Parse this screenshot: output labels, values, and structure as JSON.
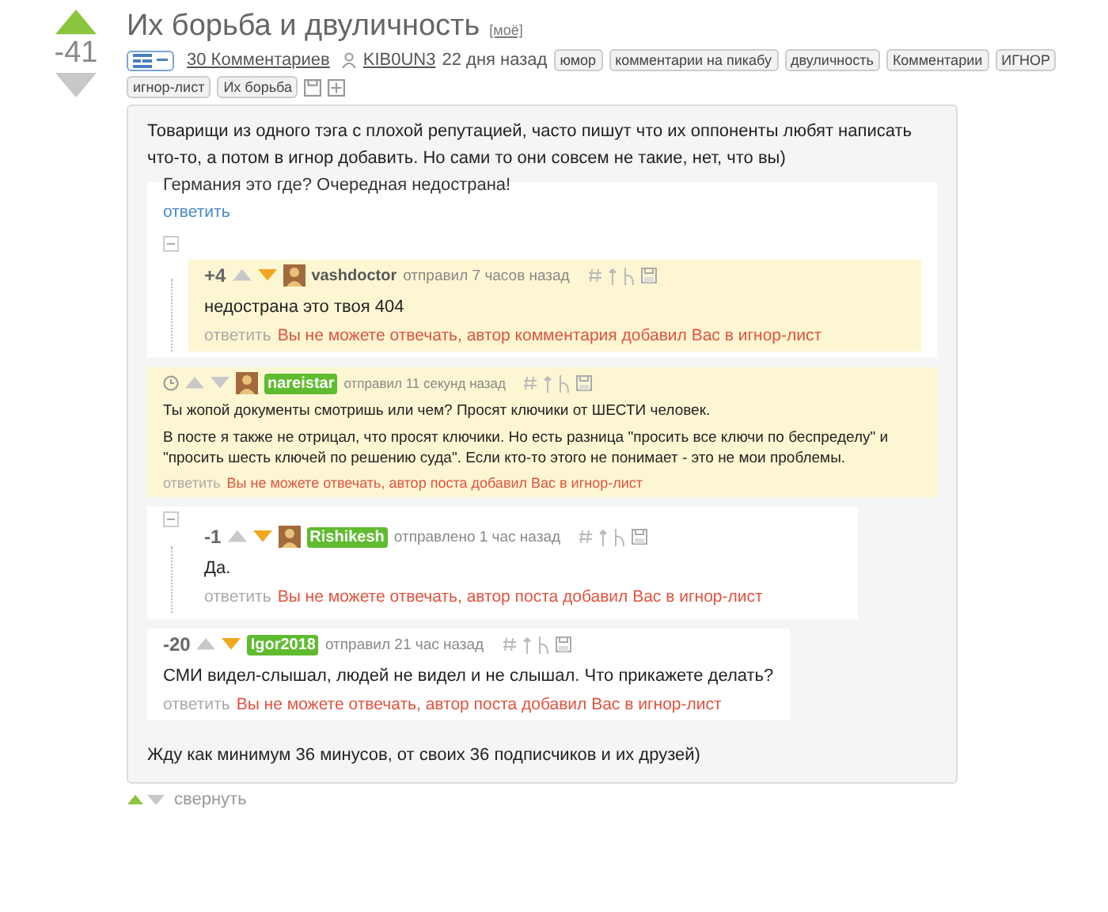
{
  "post": {
    "rating": "-41",
    "voted_up": true,
    "voted_down": false,
    "title": "Их борьба и двуличность",
    "mine_label": "[моё]",
    "comments_link": "30 Комментариев",
    "author": "KIB0UN3",
    "time": "22 дня назад",
    "tags": [
      "юмор",
      "комментарии на пикабу",
      "двуличность",
      "Комментарии",
      "ИГНОР",
      "игнор-лист",
      "Их борьба"
    ],
    "intro": "Товарищи из одного тэга с плохой репутацией, часто пишут что их оппоненты любят написать что-то, а потом в игнор добавить. Но сами то они совсем не такие, нет, что вы)",
    "thread": [
      {
        "kind": "fragment",
        "text": "Германия это где? Очередная недострана!",
        "reply": {
          "label": "ответить",
          "disabled": false
        },
        "children": [
          {
            "kind": "comment",
            "rating": "+4",
            "voted_down": true,
            "highlighted": true,
            "avatar": true,
            "author": "vashdoctor",
            "author_badge": false,
            "time": "отправил 7 часов назад",
            "paragraphs": [
              "недострана это твоя 404"
            ],
            "reply": {
              "label": "ответить",
              "disabled": true
            },
            "notice": "Вы не можете отвечать, автор комментария добавил Вас в игнор-лист"
          }
        ]
      },
      {
        "kind": "new",
        "voted_down": false,
        "highlighted": true,
        "avatar": true,
        "author": "nareistar",
        "author_badge": true,
        "time": "отправил 11 секунд назад",
        "paragraphs": [
          "Ты жопой документы смотришь или чем? Просят ключики от ШЕСТИ человек.",
          "В посте я также не отрицал, что просят ключики. Но есть разница \"просить все ключи по беспределу\" и \"просить шесть ключей по решению суда\". Если кто-то этого не понимает - это не мои проблемы."
        ],
        "reply": {
          "label": "ответить",
          "disabled": true
        },
        "notice": "Вы не можете отвечать, автор поста добавил Вас в игнор-лист"
      },
      {
        "kind": "group",
        "children": [
          {
            "kind": "comment",
            "rating": "-1",
            "voted_down": true,
            "highlighted": false,
            "avatar": true,
            "author": "Rishikesh",
            "author_badge": true,
            "time": "отправлено 1 час назад",
            "paragraphs": [
              "Да."
            ],
            "reply": {
              "label": "ответить",
              "disabled": true
            },
            "notice": "Вы не можете отвечать, автор поста добавил Вас в игнор-лист"
          }
        ]
      },
      {
        "kind": "comment",
        "rating": "-20",
        "voted_down": true,
        "highlighted": false,
        "avatar": false,
        "author": "Igor2018",
        "author_badge": true,
        "time": "отправил 21 час назад",
        "paragraphs": [
          "СМИ видел-слышал, людей не видел и не слышал. Что прикажете делать?"
        ],
        "reply": {
          "label": "ответить",
          "disabled": true
        },
        "notice": "Вы не можете отвечать, автор поста добавил Вас в игнор-лист"
      }
    ],
    "outro": "Жду как минимум 36 минусов, от своих 36 подписчиков и их друзей)",
    "footer": {
      "voted_up": true,
      "voted_down": false,
      "collapse": "свернуть"
    }
  }
}
